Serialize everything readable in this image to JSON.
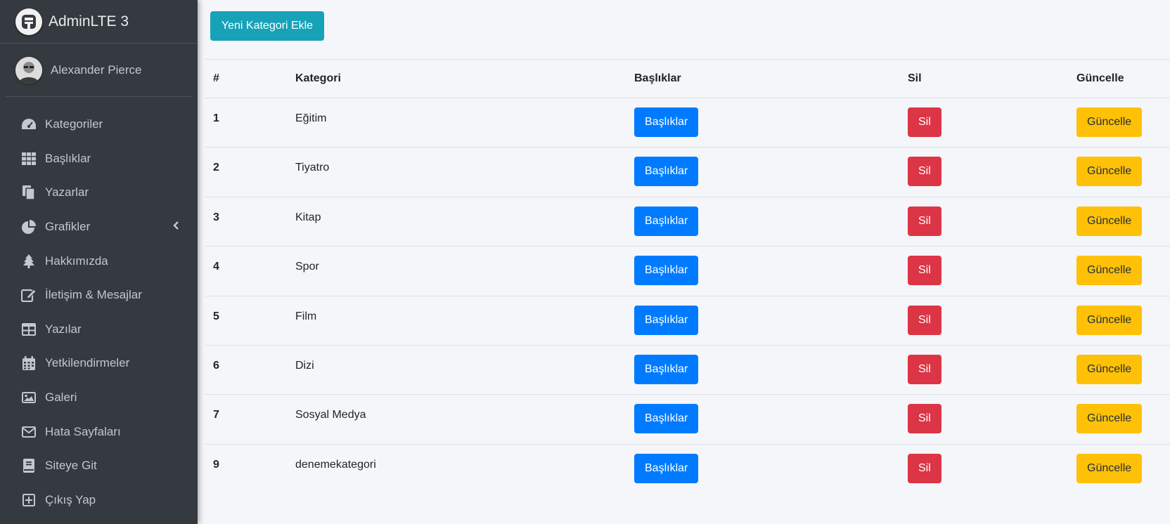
{
  "sidebar": {
    "brand": "AdminLTE 3",
    "user_name": "Alexander Pierce",
    "items": [
      {
        "label": "Kategoriler",
        "icon": "tachometer-icon"
      },
      {
        "label": "Başlıklar",
        "icon": "th-grid-icon"
      },
      {
        "label": "Yazarlar",
        "icon": "copy-icon"
      },
      {
        "label": "Grafikler",
        "icon": "pie-chart-icon"
      },
      {
        "label": "Hakkımızda",
        "icon": "tree-icon"
      },
      {
        "label": "İletişim & Mesajlar",
        "icon": "edit-icon"
      },
      {
        "label": "Yazılar",
        "icon": "table-icon"
      },
      {
        "label": "Yetkilendirmeler",
        "icon": "calendar-icon"
      },
      {
        "label": "Galeri",
        "icon": "image-icon"
      },
      {
        "label": "Hata Sayfaları",
        "icon": "envelope-icon"
      },
      {
        "label": "Siteye Git",
        "icon": "book-icon"
      },
      {
        "label": "Çıkış Yap",
        "icon": "plus-square-icon"
      }
    ]
  },
  "main": {
    "add_button": "Yeni Kategori Ekle",
    "table": {
      "headers": [
        "#",
        "Kategori",
        "Başlıklar",
        "Sil",
        "Güncelle"
      ],
      "rows": [
        {
          "id": "1",
          "name": "Eğitim"
        },
        {
          "id": "2",
          "name": "Tiyatro"
        },
        {
          "id": "3",
          "name": "Kitap"
        },
        {
          "id": "4",
          "name": "Spor"
        },
        {
          "id": "5",
          "name": "Film"
        },
        {
          "id": "6",
          "name": "Dizi"
        },
        {
          "id": "7",
          "name": "Sosyal Medya"
        },
        {
          "id": "9",
          "name": "denemekategori"
        }
      ],
      "buttons": {
        "titles": "Başlıklar",
        "delete": "Sil",
        "update": "Güncelle"
      }
    }
  },
  "colors": {
    "sidebar_bg": "#343a40",
    "info": "#17a2b8",
    "primary": "#007bff",
    "danger": "#dc3545",
    "warning": "#ffc107"
  }
}
